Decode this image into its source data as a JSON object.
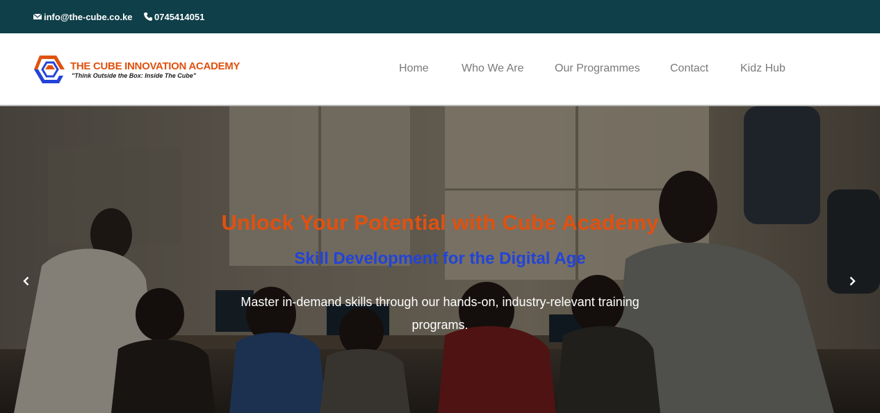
{
  "topbar": {
    "email": "info@the-cube.co.ke",
    "phone": "0745414051",
    "email_icon": "envelope-icon",
    "phone_icon": "phone-icon"
  },
  "brand": {
    "name": "THE CUBE INNOVATION ACADEMY",
    "tagline": "\"Think Outside the Box: Inside The Cube\"",
    "colors": {
      "orange": "#e0510f",
      "blue": "#2243d8",
      "teal": "#0f3f49"
    }
  },
  "nav": {
    "items": [
      {
        "label": "Home"
      },
      {
        "label": "Who We Are"
      },
      {
        "label": "Our Programmes"
      },
      {
        "label": "Contact"
      },
      {
        "label": "Kidz Hub"
      }
    ]
  },
  "hero": {
    "title": "Unlock Your Potential with Cube Academy",
    "subtitle": "Skill Development for the Digital Age",
    "description": "Master in-demand skills through our hands-on, industry-relevant training programs.",
    "prev_icon": "chevron-left-icon",
    "next_icon": "chevron-right-icon"
  }
}
